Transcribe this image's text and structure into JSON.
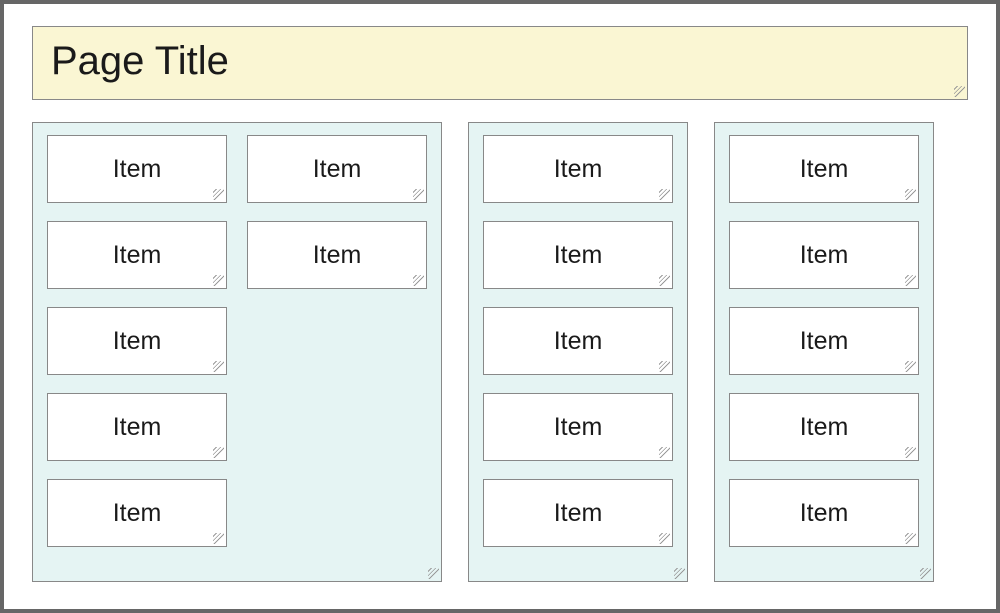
{
  "title": "Page Title",
  "columns": {
    "col1": {
      "left": [
        "Item",
        "Item",
        "Item",
        "Item",
        "Item"
      ],
      "right": [
        "Item",
        "Item"
      ]
    },
    "col2": [
      "Item",
      "Item",
      "Item",
      "Item",
      "Item"
    ],
    "col3": [
      "Item",
      "Item",
      "Item",
      "Item",
      "Item"
    ]
  },
  "colors": {
    "title_bg": "#faf6d3",
    "column_bg": "#e5f4f3",
    "item_bg": "#ffffff",
    "border": "#888888"
  }
}
